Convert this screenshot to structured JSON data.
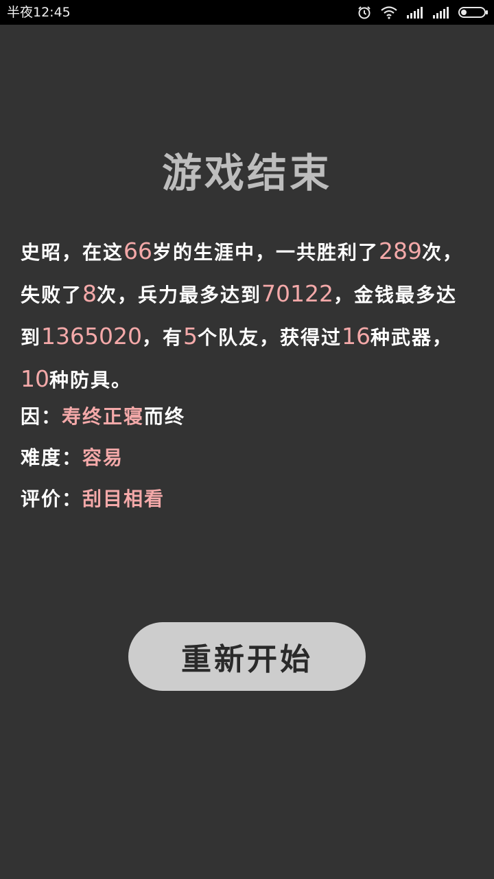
{
  "status_bar": {
    "time": "半夜12:45",
    "icons": [
      "alarm-icon",
      "wifi-icon",
      "signal-icon",
      "signal-icon",
      "battery-icon"
    ]
  },
  "title": "游戏结束",
  "summary": {
    "t1": "史昭，在这",
    "age": "66",
    "t2": "岁的生涯中，一共胜利了",
    "wins": "289",
    "t3": "次，失败了",
    "losses": "8",
    "t4": "次，兵力最多达到",
    "max_troops": "70122",
    "t5": "，金钱最多达到",
    "max_money": "1365020",
    "t6": "，有",
    "teammates": "5",
    "t7": "个队友，获得过",
    "weapons": "16",
    "t8": "种武器，",
    "armors": "10",
    "t9": "种防具。"
  },
  "cause": {
    "label": "因：",
    "value": "寿终正寝",
    "suffix": "而终"
  },
  "difficulty": {
    "label": "难度：",
    "value": "容易"
  },
  "rating": {
    "label": "评价：",
    "value": "刮目相看"
  },
  "restart_button": {
    "label": "重新开始"
  },
  "colors": {
    "background": "#333333",
    "highlight": "#f4a9a9",
    "title": "#bdbdbd",
    "button": "#cdcdcd"
  }
}
